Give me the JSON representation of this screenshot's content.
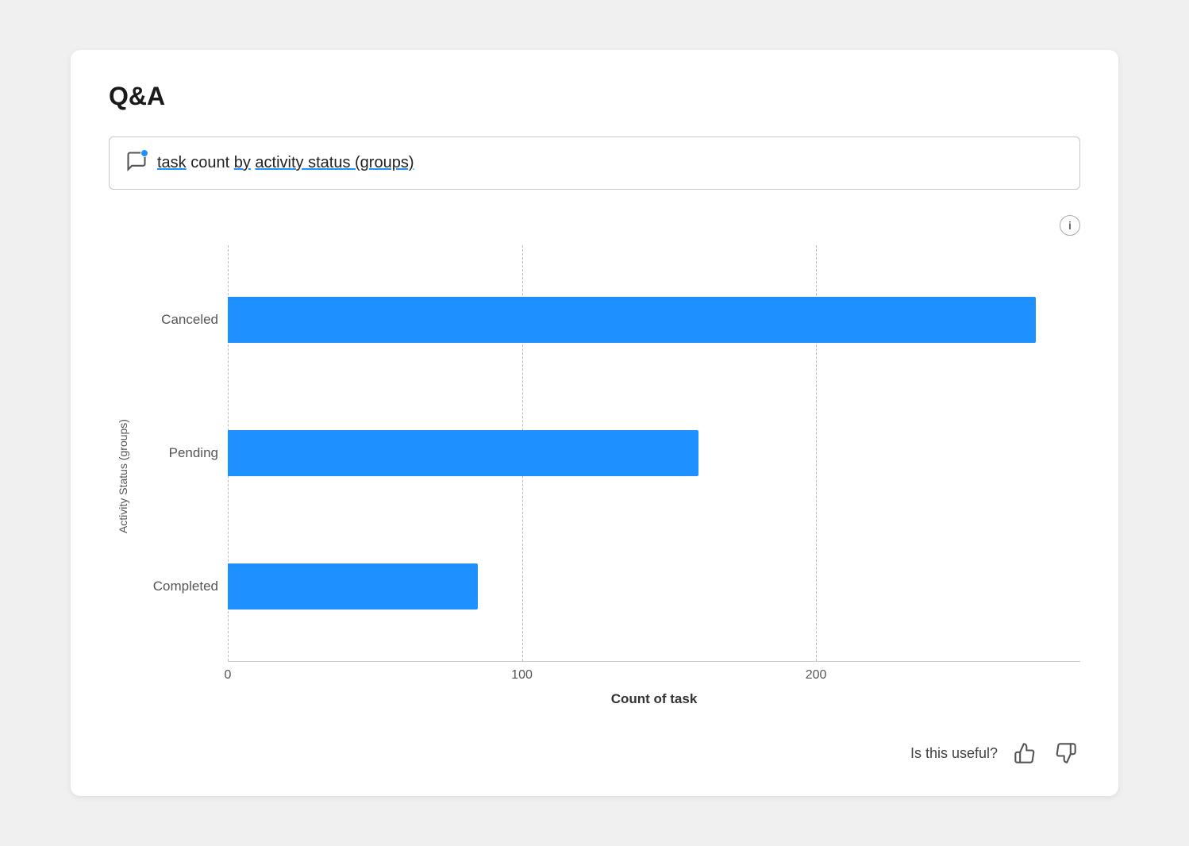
{
  "title": "Q&A",
  "query": {
    "text": "task count by activity status (groups)",
    "underlined_words": [
      "task",
      "by",
      "activity status (groups)"
    ]
  },
  "chart": {
    "y_axis_label": "Activity Status (groups)",
    "x_axis_label": "Count of task",
    "bars": [
      {
        "label": "Canceled",
        "value": 275,
        "max": 290
      },
      {
        "label": "Pending",
        "value": 160,
        "max": 290
      },
      {
        "label": "Completed",
        "value": 85,
        "max": 290
      }
    ],
    "x_ticks": [
      {
        "label": "0",
        "pct": 0
      },
      {
        "label": "100",
        "pct": 34.5
      },
      {
        "label": "200",
        "pct": 69.0
      }
    ]
  },
  "footer": {
    "useful_question": "Is this useful?",
    "thumbs_up_label": "👍",
    "thumbs_down_label": "👎"
  }
}
